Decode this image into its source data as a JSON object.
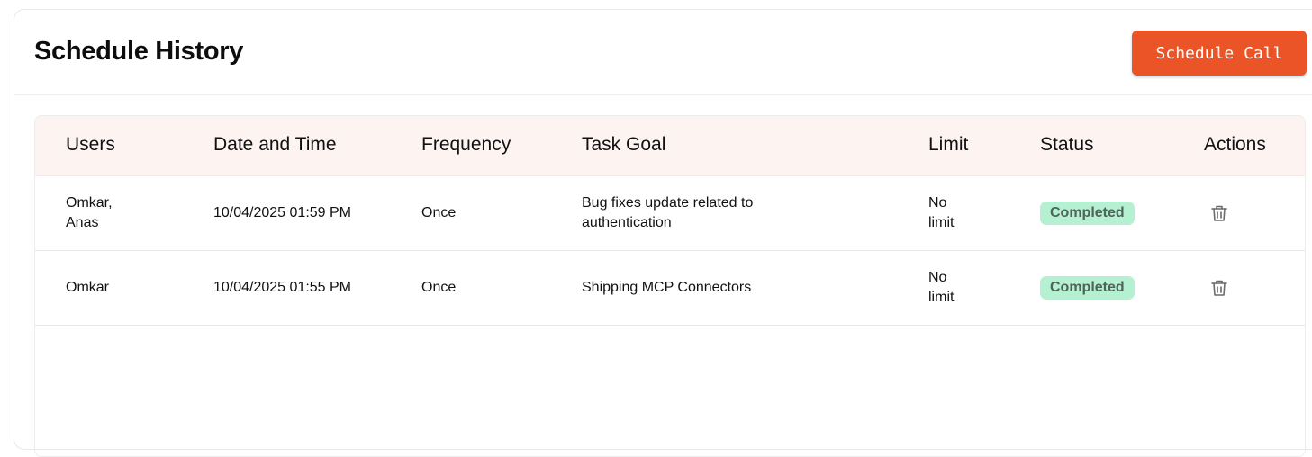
{
  "header": {
    "title": "Schedule History",
    "schedule_button_label": "Schedule Call"
  },
  "table": {
    "columns": [
      "Users",
      "Date and Time",
      "Frequency",
      "Task Goal",
      "Limit",
      "Status",
      "Actions"
    ],
    "rows": [
      {
        "users": "Omkar, Anas",
        "datetime": "10/04/2025 01:59 PM",
        "frequency": "Once",
        "task_goal": "Bug fixes update related to authentication",
        "limit": "No limit",
        "status": "Completed",
        "action_icon": "trash-icon"
      },
      {
        "users": "Omkar",
        "datetime": "10/04/2025 01:55 PM",
        "frequency": "Once",
        "task_goal": "Shipping MCP Connectors",
        "limit": "No limit",
        "status": "Completed",
        "action_icon": "trash-icon"
      }
    ]
  },
  "colors": {
    "accent": "#ea5427",
    "header_bg": "#fdf4f2",
    "status_completed_bg": "#b6f0d2",
    "status_completed_text": "#4d6457"
  }
}
